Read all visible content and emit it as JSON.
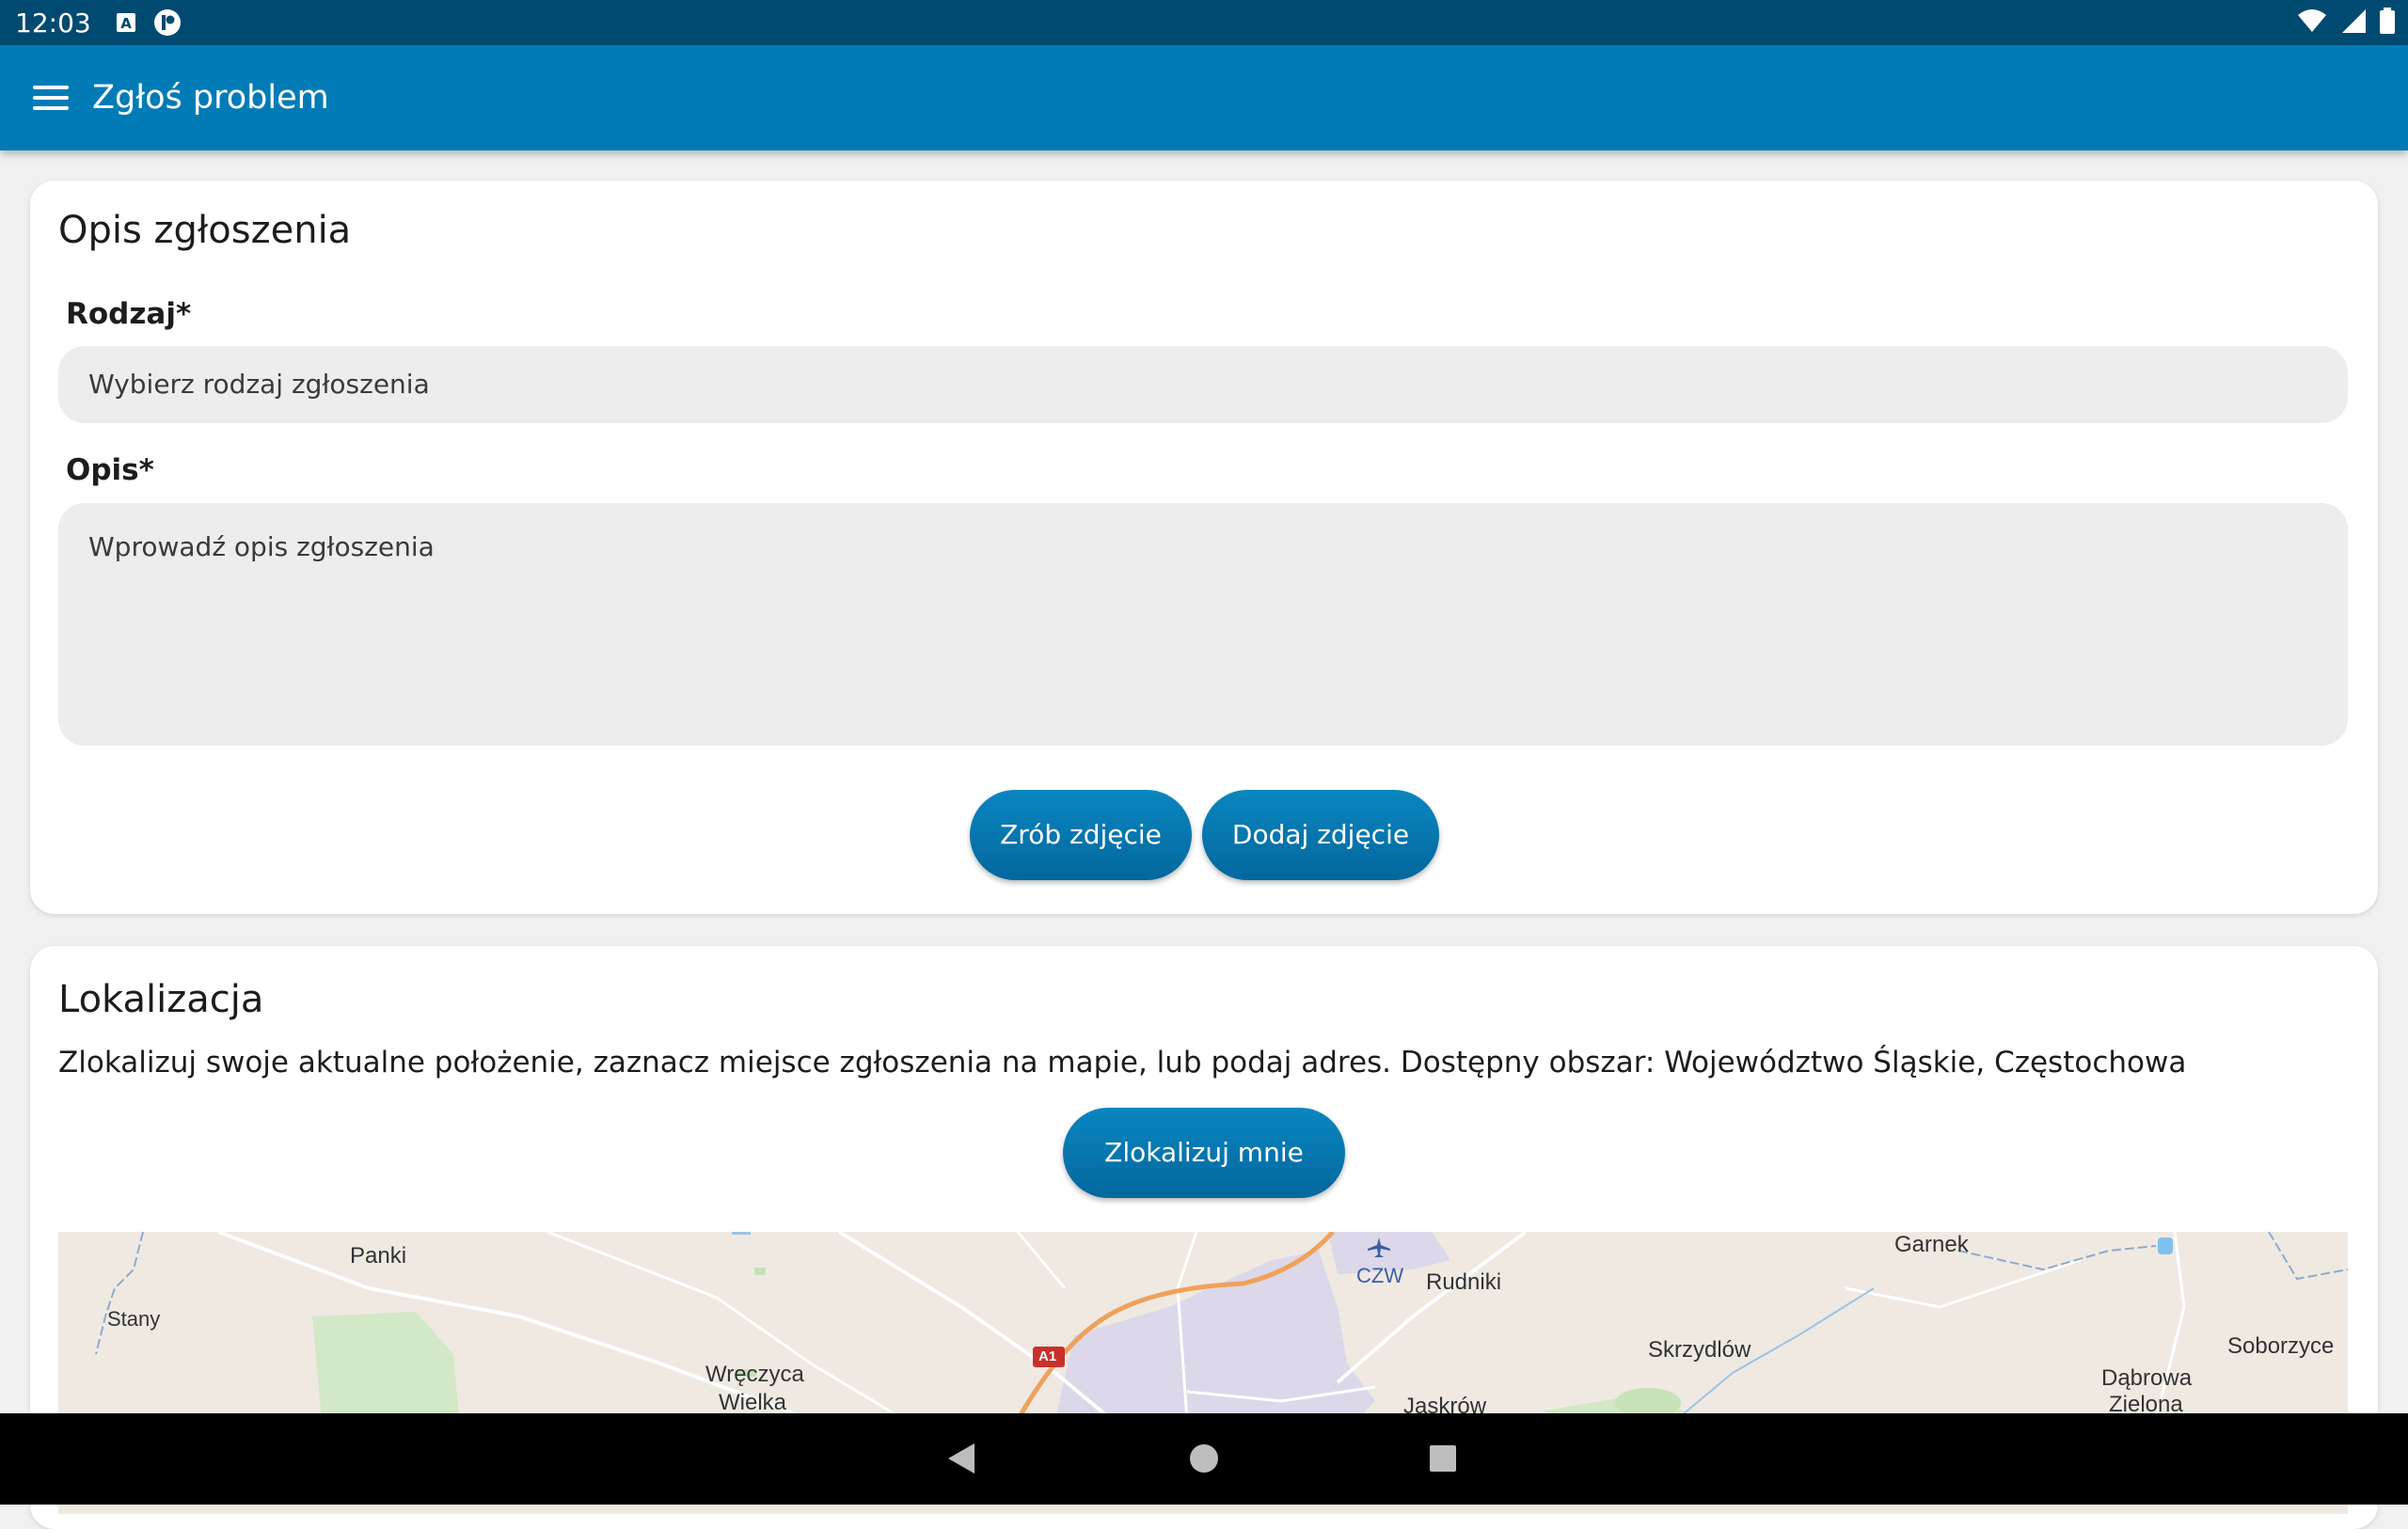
{
  "status_bar": {
    "time": "12:03",
    "icons_left": [
      "text-a-icon",
      "notification-badge-icon"
    ],
    "icons_right": [
      "wifi-icon",
      "cellular-signal-icon",
      "battery-icon"
    ]
  },
  "app_bar": {
    "menu_icon": "hamburger-menu-icon",
    "title": "Zgłoś problem",
    "background": "#017bb6"
  },
  "report_card": {
    "title": "Opis zgłoszenia",
    "type_label": "Rodzaj*",
    "type_placeholder": "Wybierz rodzaj zgłoszenia",
    "description_label": "Opis*",
    "description_placeholder": "Wprowadź opis zgłoszenia",
    "take_photo_button": "Zrób zdjęcie",
    "add_photo_button": "Dodaj zdjęcie"
  },
  "location_card": {
    "title": "Lokalizacja",
    "description": "Zlokalizuj swoje aktualne położenie, zaznacz miejsce zgłoszenia na mapie, lub podaj adres. Dostępny obszar: Województwo Śląskie, Częstochowa",
    "locate_button": "Zlokalizuj mnie"
  },
  "map": {
    "labels": {
      "panki": "Panki",
      "stany": "Stany",
      "wreczyca": "Wręczyca",
      "wielka": "Wielka",
      "czw": "CZW",
      "rudniki": "Rudniki",
      "garnek": "Garnek",
      "skrzydlow": "Skrzydlów",
      "soborzyce": "Soborzyce",
      "dabrowa": "Dąbrowa",
      "zielona": "Zielona",
      "jaskrow": "Jaskrów",
      "a1": "A1"
    }
  },
  "nav_bar": {
    "back_icon": "back-triangle-icon",
    "home_icon": "home-circle-icon",
    "recents_icon": "recents-square-icon"
  },
  "colors": {
    "primary": "#017bb6",
    "status_bar": "#004a72",
    "button": "#04709f",
    "input_bg": "#ededed"
  }
}
